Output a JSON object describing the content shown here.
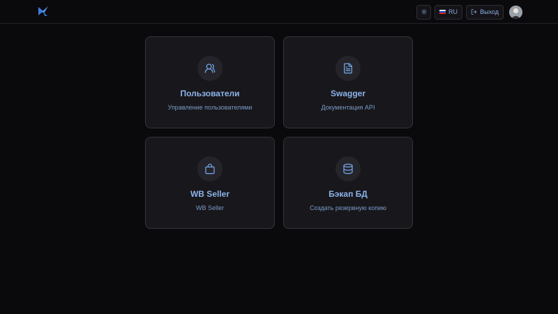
{
  "header": {
    "logo_icon": "app-logo",
    "theme_icon": "sun-icon",
    "language": "RU",
    "flag_colors": [
      "#ffffff",
      "#1c3fbf",
      "#d52b1e"
    ],
    "logout_label": "Выход",
    "logout_icon": "logout-icon"
  },
  "cards": [
    {
      "title": "Пользователи",
      "subtitle": "Управление пользователями",
      "icon": "users-icon"
    },
    {
      "title": "Swagger",
      "subtitle": "Документация API",
      "icon": "document-icon"
    },
    {
      "title": "WB Seller",
      "subtitle": "WB Seller",
      "icon": "shopping-bag-icon"
    },
    {
      "title": "Бэкап БД",
      "subtitle": "Создать резервную копию",
      "icon": "database-icon"
    }
  ],
  "colors": {
    "accent": "#8cb3ea",
    "background": "#0a090c",
    "card": "#18171b"
  }
}
